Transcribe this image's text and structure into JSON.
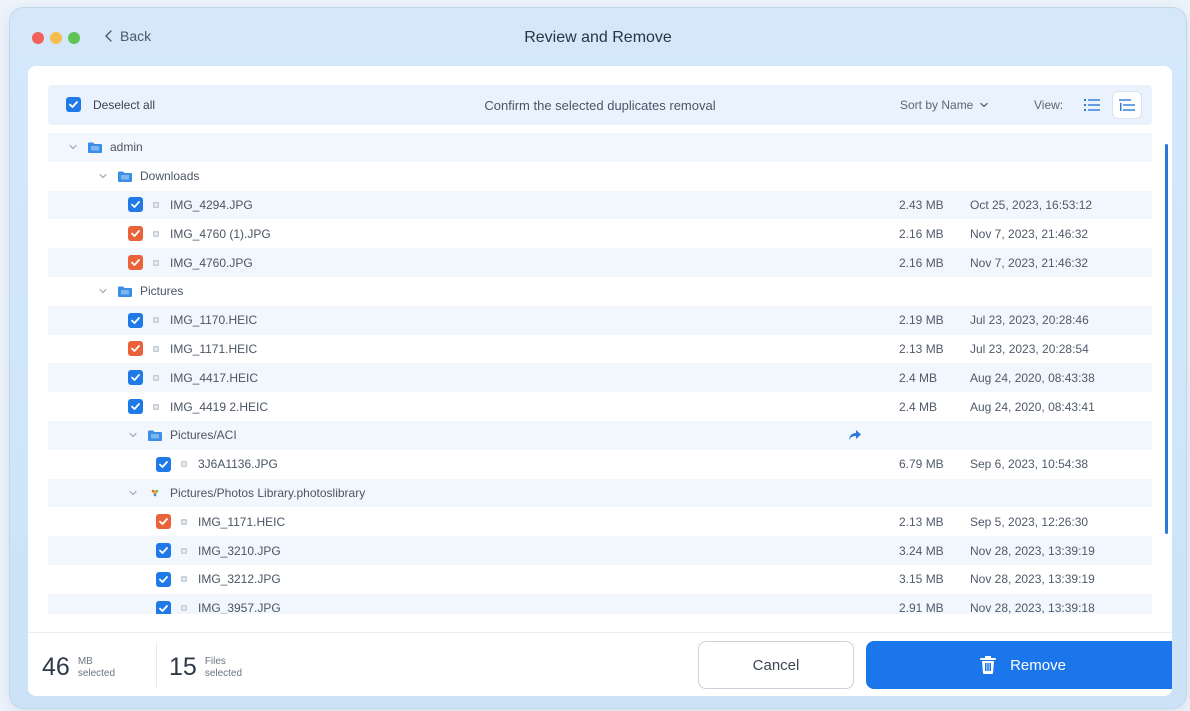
{
  "window": {
    "title": "Review and Remove",
    "back_label": "Back"
  },
  "toolbar": {
    "deselect_label": "Deselect all",
    "center_text": "Confirm the selected duplicates removal",
    "sort_label": "Sort by Name",
    "view_label": "View:"
  },
  "colors": {
    "accent": "#1a76ea",
    "checked_original": "#1f7ae8",
    "checked_duplicate": "#e9623a",
    "folder": "#3b8ee6"
  },
  "rows": [
    {
      "type": "folder",
      "level": 0,
      "label": "admin",
      "icon": "folder-icon"
    },
    {
      "type": "folder",
      "level": 1,
      "label": "Downloads",
      "icon": "folder-icon"
    },
    {
      "type": "file",
      "level": 2,
      "label": "IMG_4294.JPG",
      "size": "2.43 MB",
      "date": "Oct 25, 2023, 16:53:12",
      "check": "blue"
    },
    {
      "type": "file",
      "level": 2,
      "label": "IMG_4760 (1).JPG",
      "size": "2.16 MB",
      "date": "Nov 7, 2023, 21:46:32",
      "check": "orange"
    },
    {
      "type": "file",
      "level": 2,
      "label": "IMG_4760.JPG",
      "size": "2.16 MB",
      "date": "Nov 7, 2023, 21:46:32",
      "check": "orange"
    },
    {
      "type": "folder",
      "level": 1,
      "label": "Pictures",
      "icon": "folder-icon"
    },
    {
      "type": "file",
      "level": 2,
      "label": "IMG_1170.HEIC",
      "size": "2.19 MB",
      "date": "Jul 23, 2023, 20:28:46",
      "check": "blue"
    },
    {
      "type": "file",
      "level": 2,
      "label": "IMG_1171.HEIC",
      "size": "2.13 MB",
      "date": "Jul 23, 2023, 20:28:54",
      "check": "orange"
    },
    {
      "type": "file",
      "level": 2,
      "label": "IMG_4417.HEIC",
      "size": "2.4 MB",
      "date": "Aug 24, 2020, 08:43:38",
      "check": "blue"
    },
    {
      "type": "file",
      "level": 2,
      "label": "IMG_4419 2.HEIC",
      "size": "2.4 MB",
      "date": "Aug 24, 2020, 08:43:41",
      "check": "blue"
    },
    {
      "type": "folder",
      "level": 2,
      "label": "Pictures/ACI",
      "icon": "folder-icon",
      "reveal": true
    },
    {
      "type": "file",
      "level": 3,
      "label": "3J6A1136.JPG",
      "size": "6.79 MB",
      "date": "Sep 6, 2023, 10:54:38",
      "check": "blue"
    },
    {
      "type": "folder",
      "level": 2,
      "label": "Pictures/Photos Library.photoslibrary",
      "icon": "photos-library-icon"
    },
    {
      "type": "file",
      "level": 3,
      "label": "IMG_1171.HEIC",
      "size": "2.13 MB",
      "date": "Sep 5, 2023, 12:26:30",
      "check": "orange"
    },
    {
      "type": "file",
      "level": 3,
      "label": "IMG_3210.JPG",
      "size": "3.24 MB",
      "date": "Nov 28, 2023, 13:39:19",
      "check": "blue"
    },
    {
      "type": "file",
      "level": 3,
      "label": "IMG_3212.JPG",
      "size": "3.15 MB",
      "date": "Nov 28, 2023, 13:39:19",
      "check": "blue"
    },
    {
      "type": "file",
      "level": 3,
      "label": "IMG_3957.JPG",
      "size": "2.91 MB",
      "date": "Nov 28, 2023, 13:39:18",
      "check": "blue"
    }
  ],
  "footer": {
    "size_value": "46",
    "size_unit": "MB",
    "size_caption": "selected",
    "files_value": "15",
    "files_unit": "Files",
    "files_caption": "selected",
    "cancel_label": "Cancel",
    "remove_label": "Remove"
  }
}
